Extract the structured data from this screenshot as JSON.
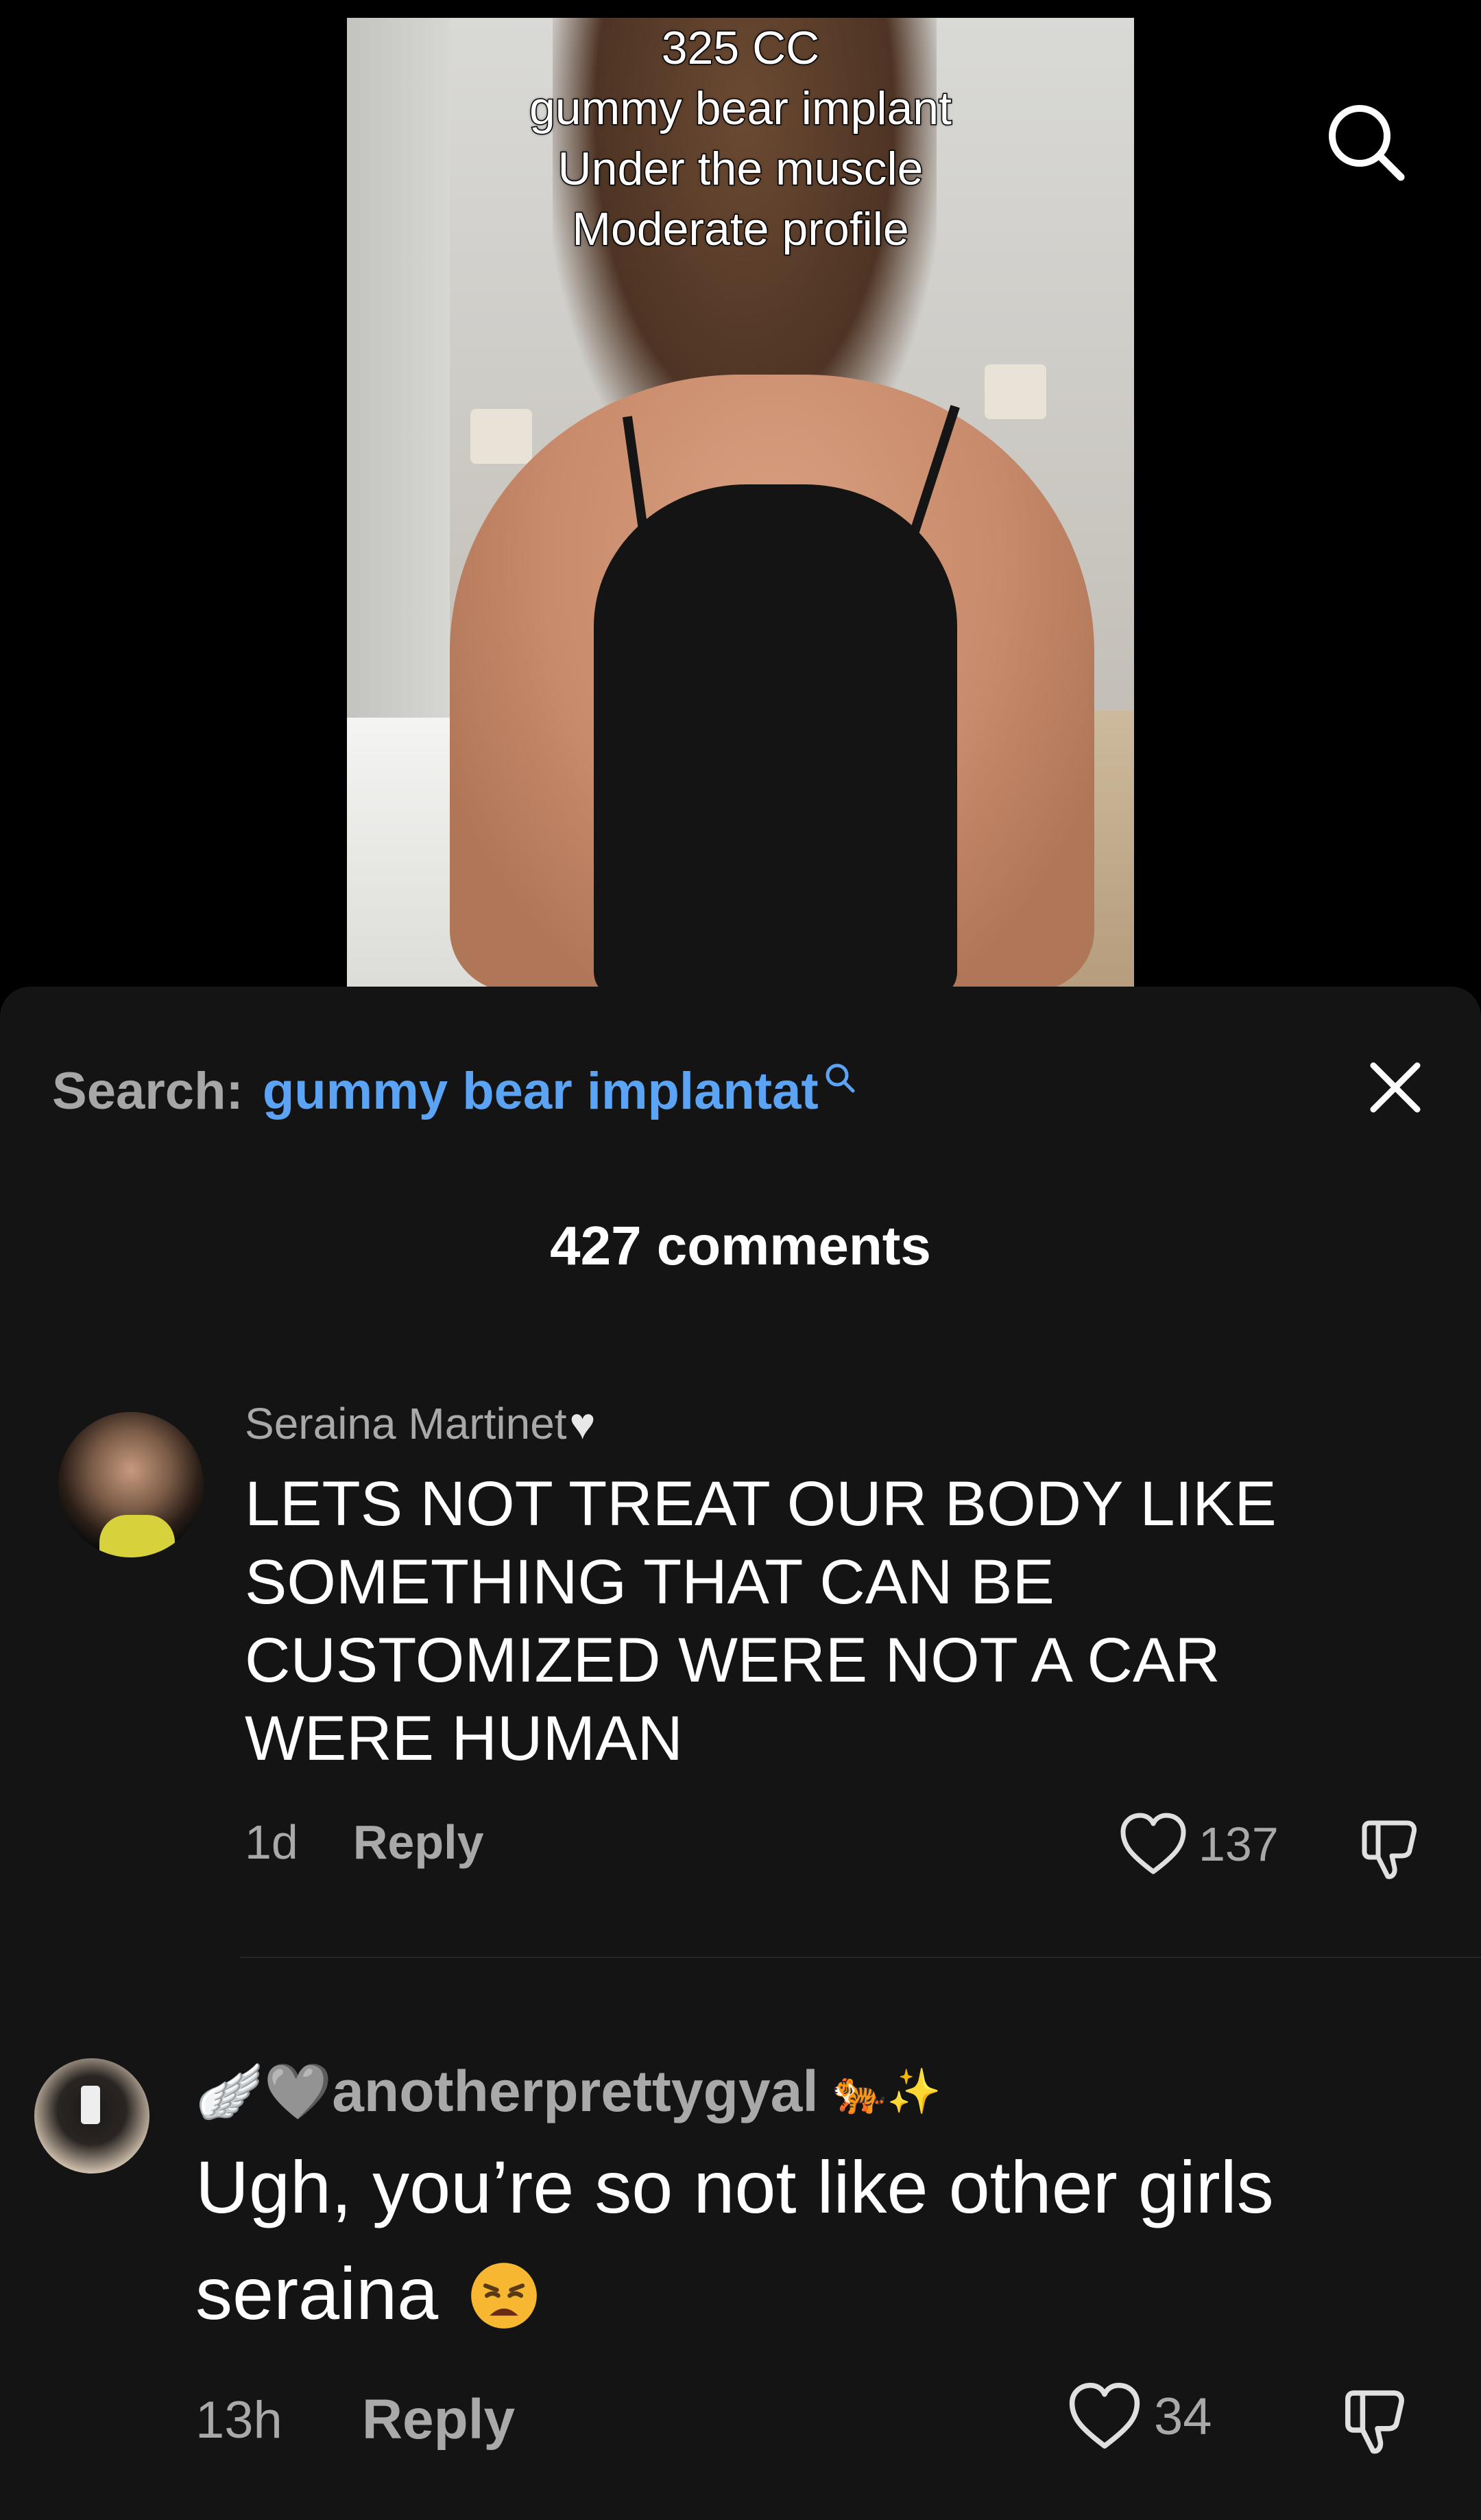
{
  "video": {
    "caption_lines": [
      "325 CC",
      "gummy bear implant",
      "Under the muscle",
      "Moderate profile"
    ],
    "search_icon": "search-icon"
  },
  "search": {
    "prefix": "Search:",
    "query": "gummy bear implantat",
    "icon": "search-icon"
  },
  "close_icon": "close-icon",
  "comments_count": "427 comments",
  "comments": [
    {
      "author": "Seraina Martinet",
      "author_badge": "♥",
      "text_lines": [
        "LETS NOT TREAT OUR BODY LIKE",
        "SOMETHING THAT CAN BE",
        "CUSTOMIZED WERE NOT A CAR",
        "WERE HUMAN"
      ],
      "time": "1d",
      "reply": "Reply",
      "likes": "137"
    },
    {
      "author_prefix_emoji": "🪽🩶",
      "author": "anotherprettygyal",
      "author_suffix_emoji": "🐅✨",
      "text_lines": [
        "Ugh, you’re so not like other girls",
        "seraina"
      ],
      "text_emoji": "😩",
      "time": "13h",
      "reply": "Reply",
      "likes": "34"
    }
  ],
  "colors": {
    "sheet_bg": "#141414",
    "search_query": "#5aa3f5",
    "muted_text": "#a9a9a9"
  }
}
